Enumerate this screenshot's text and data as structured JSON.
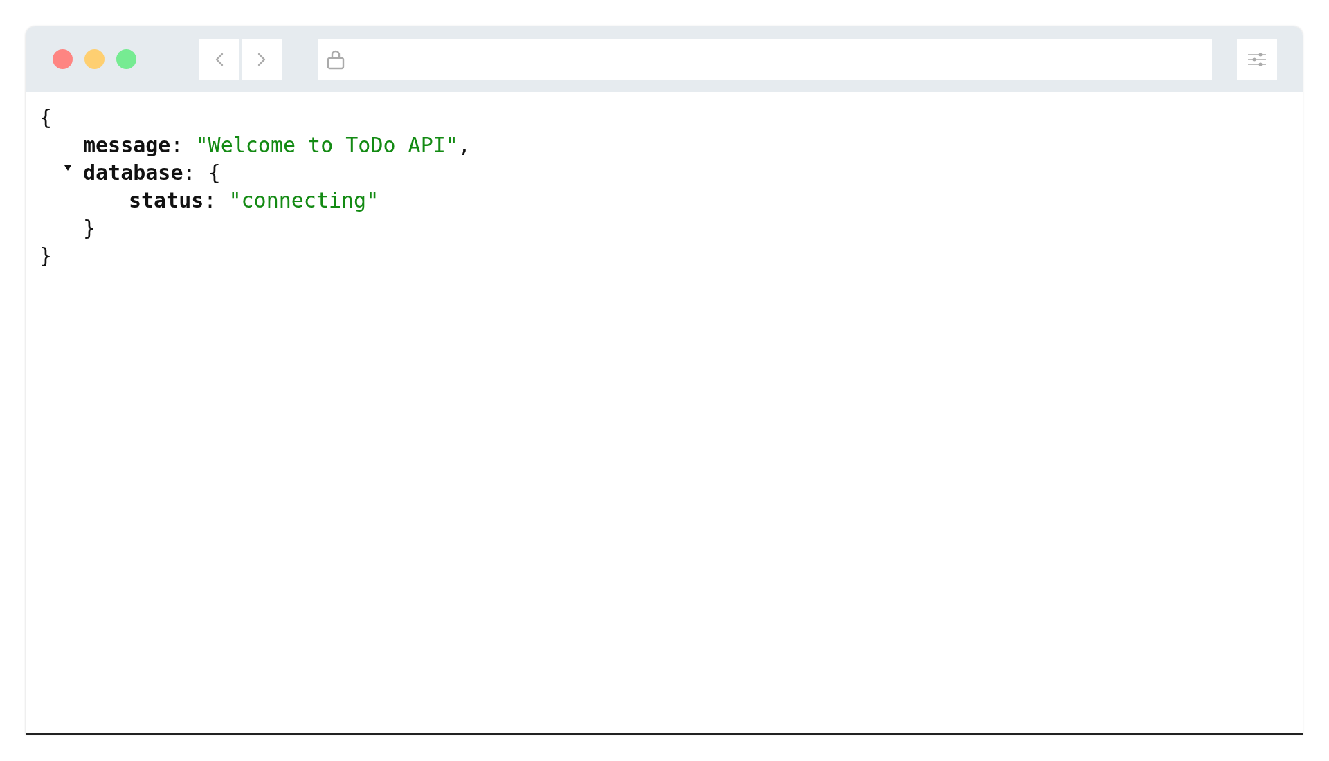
{
  "toolbar": {
    "address_bar": {
      "secure": true
    }
  },
  "json_view": {
    "open_brace": "{",
    "close_brace": "}",
    "entries": [
      {
        "kind": "string",
        "key": "message",
        "colon": ":",
        "value": "\"Welcome to ToDo API\"",
        "comma": ","
      },
      {
        "kind": "object",
        "key": "database",
        "colon": ":",
        "expanded": true,
        "open_brace": "{",
        "close_brace": "}",
        "children": [
          {
            "kind": "string",
            "key": "status",
            "colon": ":",
            "value": "\"connecting\""
          }
        ]
      }
    ]
  }
}
